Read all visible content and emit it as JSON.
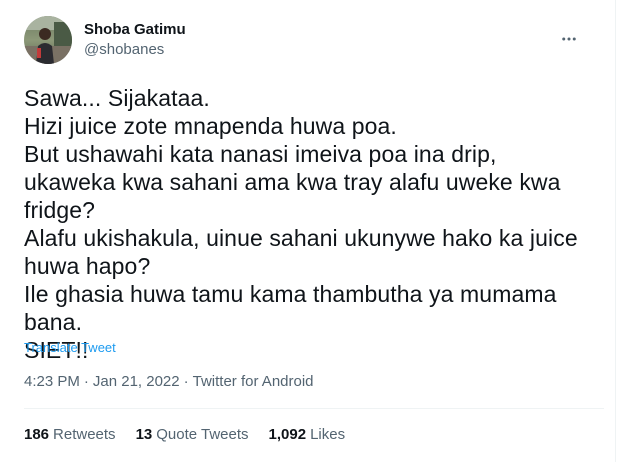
{
  "author": {
    "display_name": "Shoba Gatimu",
    "handle": "@shobanes",
    "avatar_icon": "profile-photo"
  },
  "more_icon": "more-horizontal-icon",
  "tweet": {
    "text": "Sawa... Sijakataa.\nHizi juice zote mnapenda huwa poa.\nBut ushawahi kata nanasi imeiva poa ina drip, ukaweka kwa sahani ama kwa tray alafu uweke kwa fridge?\nAlafu ukishakula, uinue sahani ukunywe hako ka juice huwa hapo?\nIle ghasia huwa tamu kama thambutha ya mumama bana.\nSIET!!",
    "translate_label": "Translate Tweet"
  },
  "meta": {
    "time": "4:23 PM",
    "separator": "·",
    "date": "Jan 21, 2022",
    "source": "Twitter for Android"
  },
  "stats": [
    {
      "count": "186",
      "label": "Retweets"
    },
    {
      "count": "13",
      "label": "Quote Tweets"
    },
    {
      "count": "1,092",
      "label": "Likes"
    }
  ],
  "colors": {
    "text_primary": "#0f1419",
    "text_secondary": "#536471",
    "link": "#1d9bf0",
    "divider": "#eff3f4"
  }
}
